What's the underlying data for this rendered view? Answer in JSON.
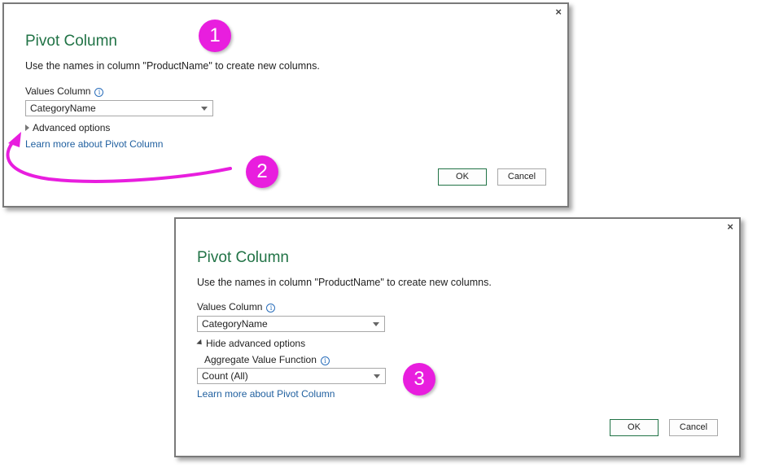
{
  "dialog1": {
    "title": "Pivot Column",
    "description": "Use the names in column \"ProductName\" to create new columns.",
    "values_column_label": "Values Column",
    "values_column_value": "CategoryName",
    "advanced_label": "Advanced options",
    "learn_more": "Learn more about Pivot Column",
    "ok_label": "OK",
    "cancel_label": "Cancel",
    "close_label": "×"
  },
  "dialog2": {
    "title": "Pivot Column",
    "description": "Use the names in column \"ProductName\" to create new columns.",
    "values_column_label": "Values Column",
    "values_column_value": "CategoryName",
    "advanced_label": "Hide advanced options",
    "aggregate_label": "Aggregate Value Function",
    "aggregate_value": "Count (All)",
    "learn_more": "Learn more about Pivot Column",
    "ok_label": "OK",
    "cancel_label": "Cancel",
    "close_label": "×"
  },
  "annotations": {
    "badge1": "1",
    "badge2": "2",
    "badge3": "3",
    "color": "#e81ede"
  },
  "colors": {
    "title_green": "#217346",
    "link_blue": "#1f5f9f"
  },
  "icons": [
    "close-icon",
    "info-icon",
    "chevron-down-icon",
    "expand-triangle-icon",
    "collapse-triangle-icon"
  ]
}
